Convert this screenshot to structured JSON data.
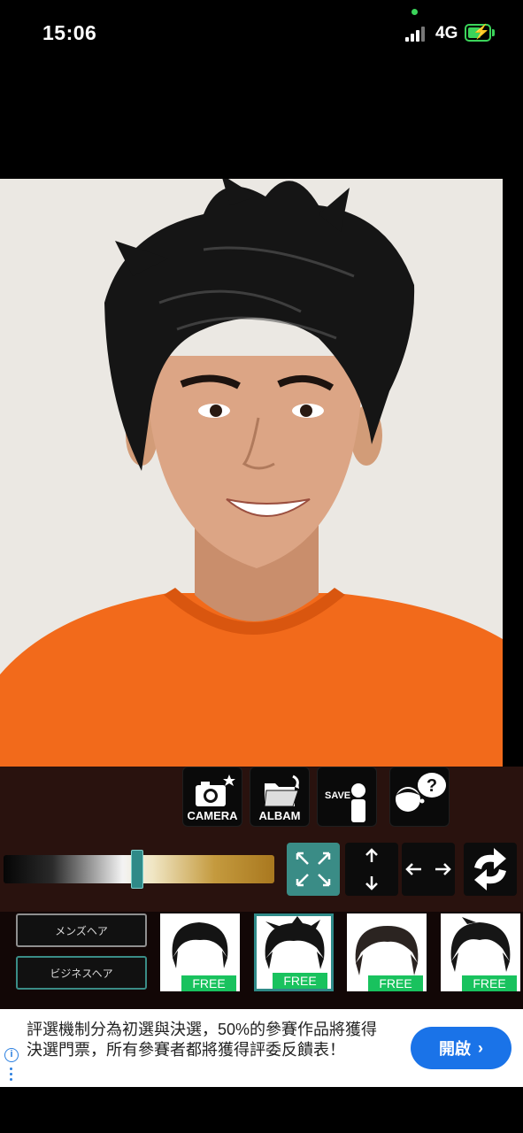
{
  "status_bar": {
    "time": "15:06",
    "network": "4G"
  },
  "toolbar": {
    "camera_label": "CAMERA",
    "album_label": "ALBAM",
    "save_label": "SAVE"
  },
  "categories": {
    "mens": "メンズヘア",
    "business": "ビジネスヘア"
  },
  "hairstyles": [
    {
      "badge": "FREE"
    },
    {
      "badge": "FREE"
    },
    {
      "badge": "FREE"
    },
    {
      "badge": "FREE"
    }
  ],
  "ad": {
    "text": "評選機制分為初選與決選，50%的參賽作品將獲得決選門票，所有參賽者都將獲得評委反饋表！",
    "button": "開啟"
  },
  "colors": {
    "accent": "#3a8c86",
    "free_badge": "#19c25e",
    "ad_button": "#1a73e8",
    "shirt": "#f26a1b"
  }
}
